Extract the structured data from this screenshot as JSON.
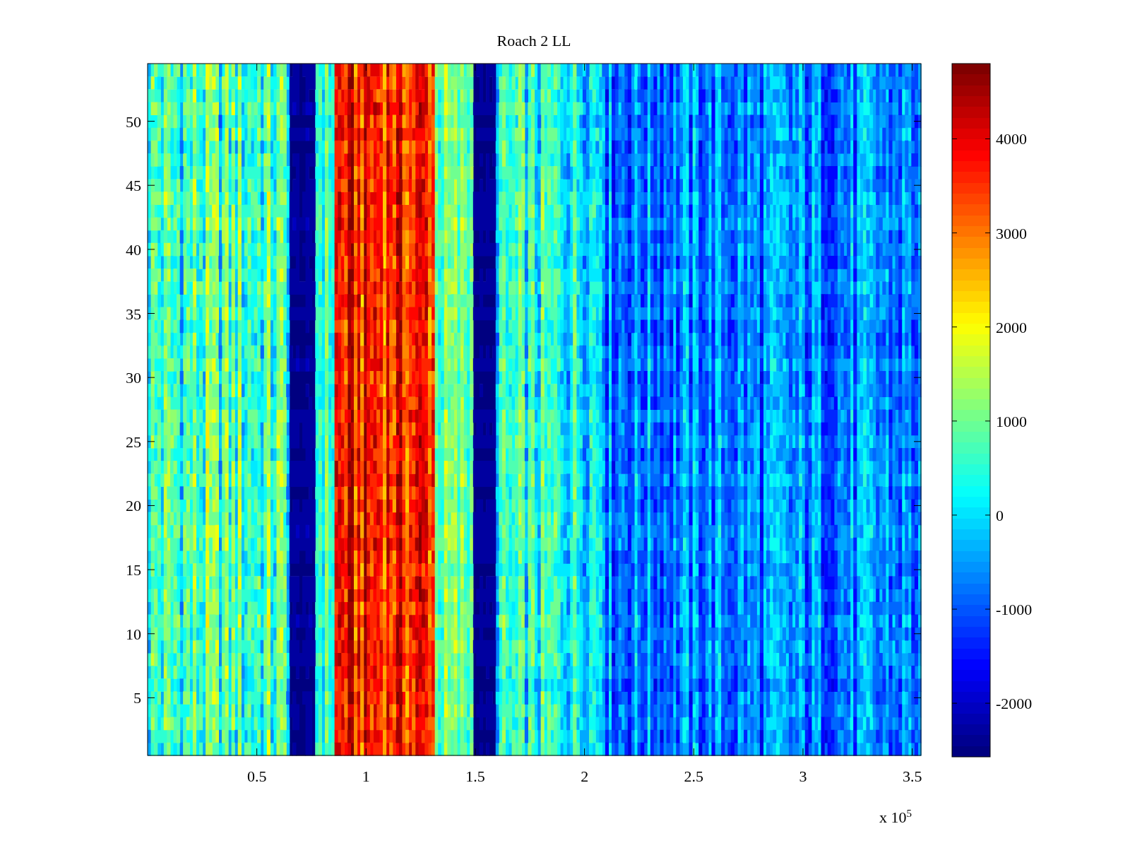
{
  "figure": {
    "title": "Roach 2 LL",
    "x_axis": {
      "ticks": [
        "0.5",
        "1",
        "1.5",
        "2",
        "2.5",
        "3",
        "3.5"
      ],
      "multiplier": "x 10$^{5}$"
    },
    "y_axis": {
      "ticks": [
        "50",
        "45",
        "40",
        "35",
        "30",
        "25",
        "20",
        "15",
        "10",
        "5"
      ]
    },
    "colorbar": {
      "ticks": [
        "4000",
        "3000",
        "2000",
        "1000",
        "0",
        "-1000",
        "-2000"
      ]
    }
  }
}
